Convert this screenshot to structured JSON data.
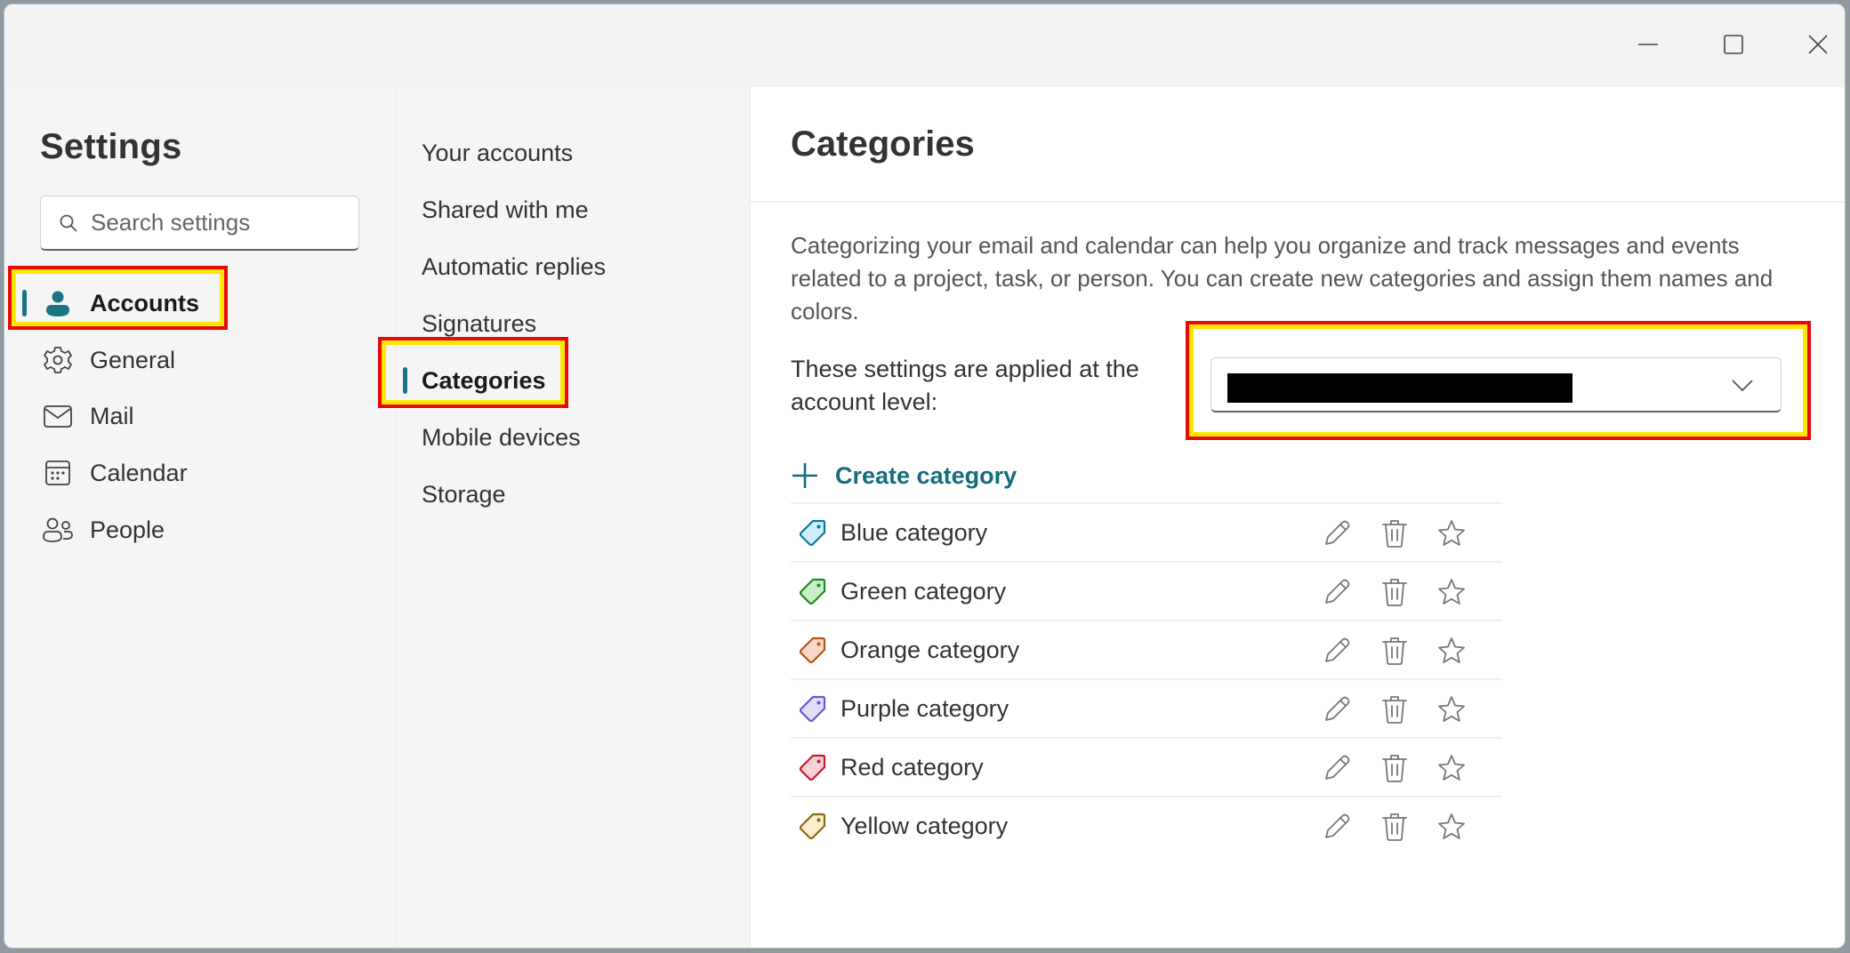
{
  "window": {
    "controls": {
      "minimize": "minimize",
      "maximize": "maximize",
      "close": "close"
    }
  },
  "sidebar": {
    "title": "Settings",
    "search": {
      "placeholder": "Search settings",
      "value": ""
    },
    "items": [
      {
        "label": "Accounts",
        "icon": "person-icon",
        "active": true
      },
      {
        "label": "General",
        "icon": "gear-icon",
        "active": false
      },
      {
        "label": "Mail",
        "icon": "mail-icon",
        "active": false
      },
      {
        "label": "Calendar",
        "icon": "calendar-icon",
        "active": false
      },
      {
        "label": "People",
        "icon": "people-icon",
        "active": false
      }
    ]
  },
  "subnav": {
    "items": [
      {
        "label": "Your accounts",
        "active": false
      },
      {
        "label": "Shared with me",
        "active": false
      },
      {
        "label": "Automatic replies",
        "active": false
      },
      {
        "label": "Signatures",
        "active": false
      },
      {
        "label": "Categories",
        "active": true
      },
      {
        "label": "Mobile devices",
        "active": false
      },
      {
        "label": "Storage",
        "active": false
      }
    ]
  },
  "main": {
    "title": "Categories",
    "description": "Categorizing your email and calendar can help you organize and track messages and events related to a project, task, or person. You can create new categories and assign them names and colors.",
    "account_level_label": "These settings are applied at the account level:",
    "account_select": {
      "value": "[redacted]"
    },
    "create_label": "Create category",
    "categories": [
      {
        "name": "Blue category",
        "fill": "#cdeefa",
        "stroke": "#0a7a9a"
      },
      {
        "name": "Green category",
        "fill": "#cdeecd",
        "stroke": "#1f8a1f"
      },
      {
        "name": "Orange category",
        "fill": "#f7d8c8",
        "stroke": "#b5541a"
      },
      {
        "name": "Purple category",
        "fill": "#e2dcfa",
        "stroke": "#6a54d0"
      },
      {
        "name": "Red category",
        "fill": "#f8d2d6",
        "stroke": "#c8192b"
      },
      {
        "name": "Yellow category",
        "fill": "#fcedcc",
        "stroke": "#8a6a10"
      }
    ],
    "row_actions": {
      "edit": "Edit",
      "delete": "Delete",
      "favorite": "Add to favorites"
    }
  },
  "theme": {
    "accent": "#1b7383",
    "link": "#146c7c",
    "highlight_outer": "#e60a0a",
    "highlight_inner": "#ffe600"
  }
}
